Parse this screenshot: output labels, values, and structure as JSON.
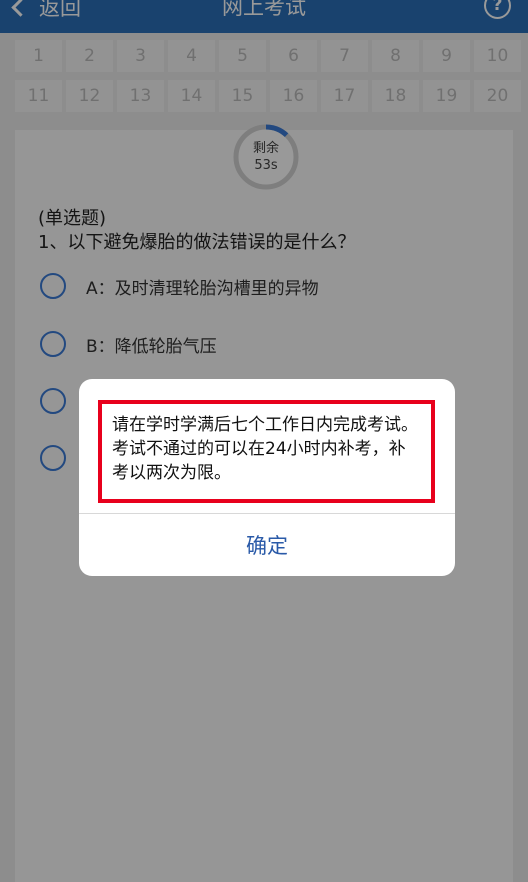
{
  "navbar": {
    "back_label": "返回",
    "title": "网上考试",
    "help_symbol": "?"
  },
  "question_grid": [
    "1",
    "2",
    "3",
    "4",
    "5",
    "6",
    "7",
    "8",
    "9",
    "10",
    "11",
    "12",
    "13",
    "14",
    "15",
    "16",
    "17",
    "18",
    "19",
    "20"
  ],
  "timer": {
    "label": "剩余",
    "remaining": "53s",
    "progress_fraction": 0.12,
    "accent": "#3b7bd6"
  },
  "question": {
    "type": "(单选题)",
    "text": "1、以下避免爆胎的做法错误的是什么？",
    "options": [
      {
        "label": "A：及时清理轮胎沟槽里的异物"
      },
      {
        "label": "B：降低轮胎气压"
      },
      {
        "label": ""
      },
      {
        "label": ""
      }
    ]
  },
  "dialog": {
    "message": "请在学时学满后七个工作日内完成考试。考试不通过的可以在24小时内补考，补考以两次为限。",
    "confirm_label": "确定",
    "highlight_color": "#e8001c"
  }
}
